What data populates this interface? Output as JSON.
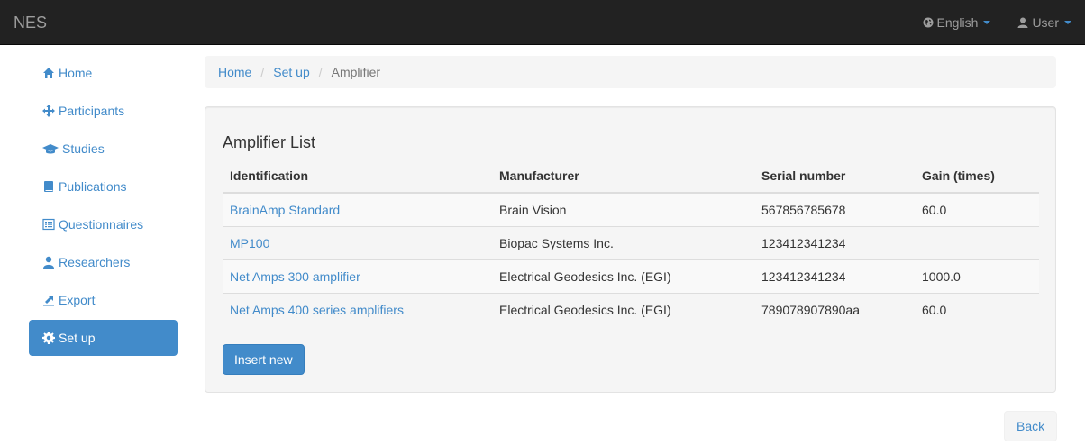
{
  "navbar": {
    "brand": "NES",
    "language": "English",
    "user": "User"
  },
  "sidebar": {
    "items": [
      {
        "label": "Home",
        "icon": "home-icon"
      },
      {
        "label": "Participants",
        "icon": "move-icon"
      },
      {
        "label": "Studies",
        "icon": "education-icon"
      },
      {
        "label": "Publications",
        "icon": "book-icon"
      },
      {
        "label": "Questionnaires",
        "icon": "list-alt-icon"
      },
      {
        "label": "Researchers",
        "icon": "user-icon"
      },
      {
        "label": "Export",
        "icon": "export-icon"
      },
      {
        "label": "Set up",
        "icon": "cog-icon",
        "active": true
      }
    ]
  },
  "breadcrumb": {
    "items": [
      "Home",
      "Set up"
    ],
    "current": "Amplifier"
  },
  "panel": {
    "title": "Amplifier List",
    "columns": [
      "Identification",
      "Manufacturer",
      "Serial number",
      "Gain (times)"
    ],
    "rows": [
      {
        "identification": "BrainAmp Standard",
        "manufacturer": "Brain Vision",
        "serial": "567856785678",
        "gain": "60.0"
      },
      {
        "identification": "MP100",
        "manufacturer": "Biopac Systems Inc.",
        "serial": "123412341234",
        "gain": ""
      },
      {
        "identification": "Net Amps 300 amplifier",
        "manufacturer": "Electrical Geodesics Inc. (EGI)",
        "serial": "123412341234",
        "gain": "1000.0"
      },
      {
        "identification": "Net Amps 400 series amplifiers",
        "manufacturer": "Electrical Geodesics Inc. (EGI)",
        "serial": "789078907890aa",
        "gain": "60.0"
      }
    ],
    "insert_label": "Insert new"
  },
  "back_label": "Back",
  "colors": {
    "accent": "#428bca",
    "navbar_bg": "#222222",
    "panel_bg": "#f5f5f5"
  }
}
